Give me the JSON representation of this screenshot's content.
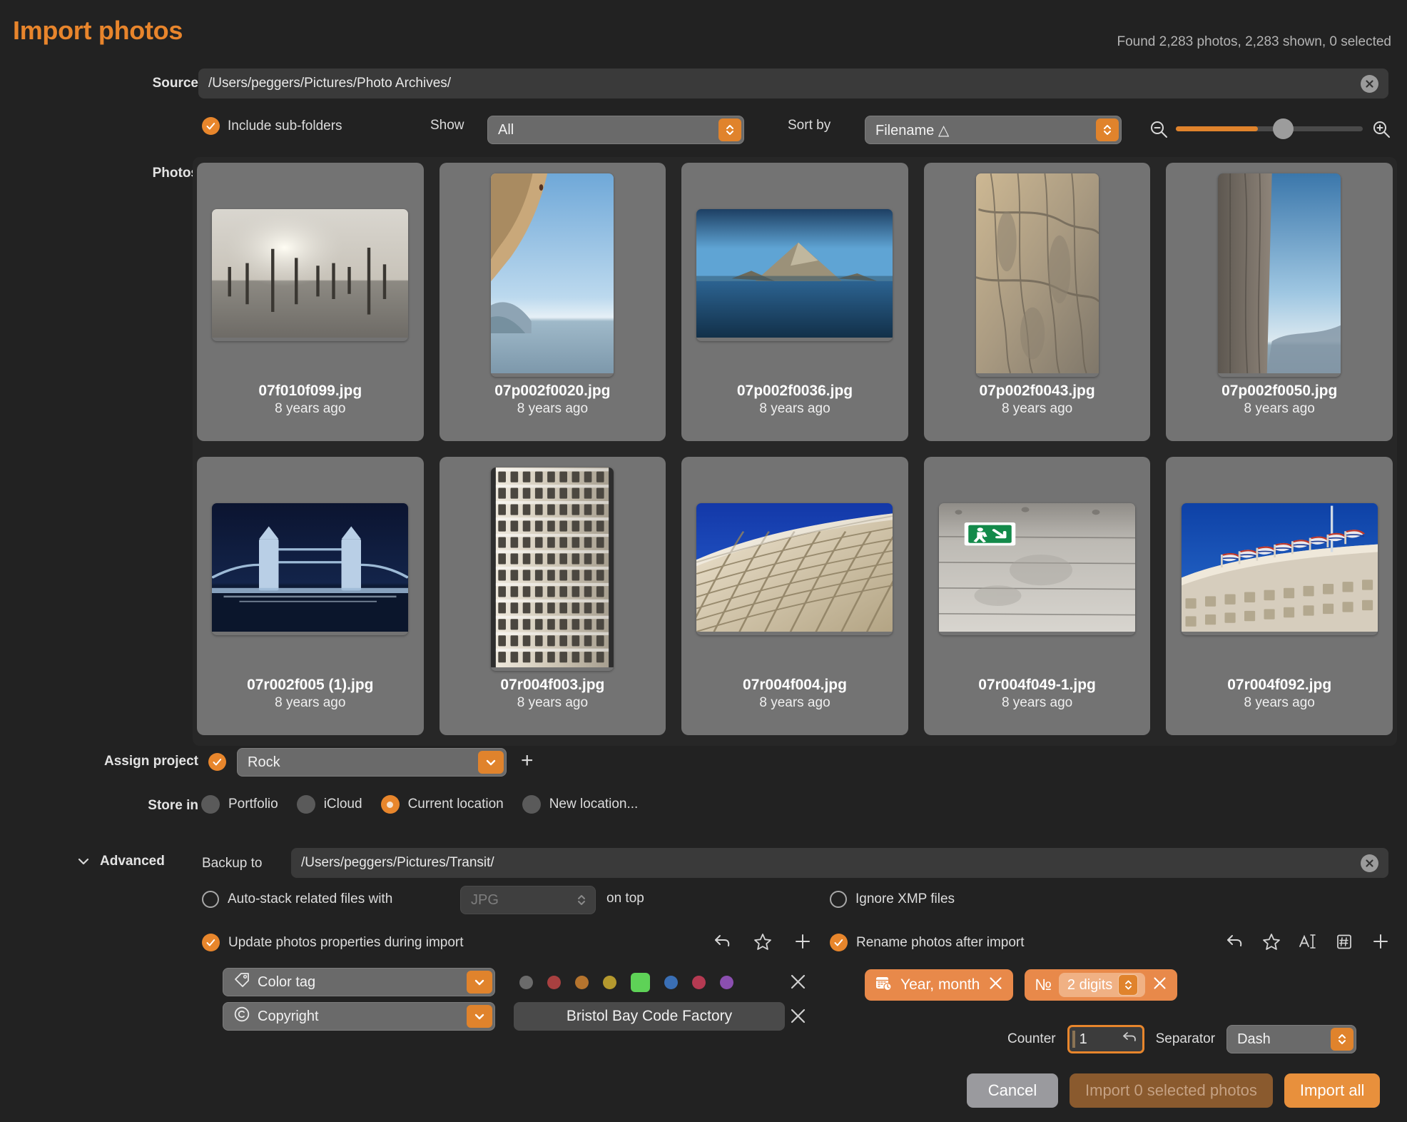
{
  "header": {
    "title": "Import photos",
    "status": "Found 2,283 photos, 2,283 shown, 0 selected"
  },
  "source": {
    "label": "Source",
    "value": "/Users/peggers/Pictures/Photo Archives/",
    "clear_icon": "close-circle-icon"
  },
  "options": {
    "include_subfolders_label": "Include sub-folders",
    "include_subfolders_checked": true,
    "show_label": "Show",
    "show_value": "All",
    "sort_label": "Sort by",
    "sort_value": "Filename △",
    "zoom_out_icon": "zoom-out-icon",
    "zoom_in_icon": "zoom-in-icon",
    "zoom_level": 44
  },
  "photos": {
    "label": "Photos",
    "items": [
      {
        "filename": "07f010f099.jpg",
        "date": "8 years ago",
        "orientation": "landscape",
        "kind": "poles-sunset"
      },
      {
        "filename": "07p002f0020.jpg",
        "date": "8 years ago",
        "orientation": "portrait",
        "kind": "cliff-sea"
      },
      {
        "filename": "07p002f0036.jpg",
        "date": "8 years ago",
        "orientation": "landscape",
        "kind": "island"
      },
      {
        "filename": "07p002f0043.jpg",
        "date": "8 years ago",
        "orientation": "portrait",
        "kind": "rock-wall"
      },
      {
        "filename": "07p002f0050.jpg",
        "date": "8 years ago",
        "orientation": "portrait",
        "kind": "rock-sky"
      },
      {
        "filename": "07r002f005 (1).jpg",
        "date": "8 years ago",
        "orientation": "landscape",
        "kind": "tower-bridge"
      },
      {
        "filename": "07r004f003.jpg",
        "date": "8 years ago",
        "orientation": "portrait",
        "kind": "round-building"
      },
      {
        "filename": "07r004f004.jpg",
        "date": "8 years ago",
        "orientation": "landscape",
        "kind": "metropol"
      },
      {
        "filename": "07r004f049-1.jpg",
        "date": "8 years ago",
        "orientation": "landscape",
        "kind": "concrete-exit"
      },
      {
        "filename": "07r004f092.jpg",
        "date": "8 years ago",
        "orientation": "landscape",
        "kind": "admiralty-arch"
      }
    ]
  },
  "assign_project": {
    "label": "Assign project",
    "checked": true,
    "value": "Rock",
    "add_icon": "plus-icon"
  },
  "store_in": {
    "label": "Store in",
    "options": [
      "Portfolio",
      "iCloud",
      "Current location",
      "New location..."
    ],
    "selected": "Current location"
  },
  "advanced": {
    "label": "Advanced",
    "expanded": true,
    "disclosure_icon": "chevron-down-icon",
    "backup_label": "Backup to",
    "backup_value": "/Users/peggers/Pictures/Transit/",
    "clear_icon": "close-circle-icon",
    "autostack": {
      "label_before": "Auto-stack related files with",
      "value": "JPG",
      "label_after": "on top",
      "checked": false,
      "disabled": true
    },
    "ignore_xmp": {
      "label": "Ignore XMP files",
      "checked": false
    },
    "update_props": {
      "label": "Update photos properties during import",
      "checked": true,
      "icons": [
        "undo-icon",
        "star-icon",
        "plus-icon"
      ],
      "rows": [
        {
          "type": "color-tag",
          "field_icon": "tag-icon",
          "field_label": "Color tag",
          "swatches": [
            "#6b6b6b",
            "#a84040",
            "#b5742e",
            "#b5992e",
            "#5ed257",
            "#3a6fb5",
            "#b53a52",
            "#8b4fb0"
          ],
          "selected_swatch_index": 4,
          "remove_icon": "close-icon"
        },
        {
          "type": "copyright",
          "field_icon": "copyright-icon",
          "field_label": "Copyright",
          "value": "Bristol Bay Code Factory",
          "remove_icon": "close-icon"
        }
      ]
    },
    "rename": {
      "label": "Rename photos after import",
      "checked": true,
      "icons": [
        "undo-icon",
        "star-icon",
        "text-cursor-icon",
        "number-box-icon",
        "plus-icon"
      ],
      "tokens": [
        {
          "icon": "calendar-clock-icon",
          "label": "Year, month",
          "remove_icon": "close-icon"
        },
        {
          "icon": "numero-icon",
          "label": "№",
          "inner_value": "2 digits",
          "remove_icon": "close-icon"
        }
      ],
      "counter_label": "Counter",
      "counter_value": "1",
      "counter_reset_icon": "undo-icon",
      "separator_label": "Separator",
      "separator_value": "Dash"
    }
  },
  "footer": {
    "cancel": "Cancel",
    "import_selected": "Import 0 selected photos",
    "import_all": "Import all"
  },
  "colors": {
    "accent": "#e8862c",
    "background": "#222222",
    "cell": "#737373"
  }
}
